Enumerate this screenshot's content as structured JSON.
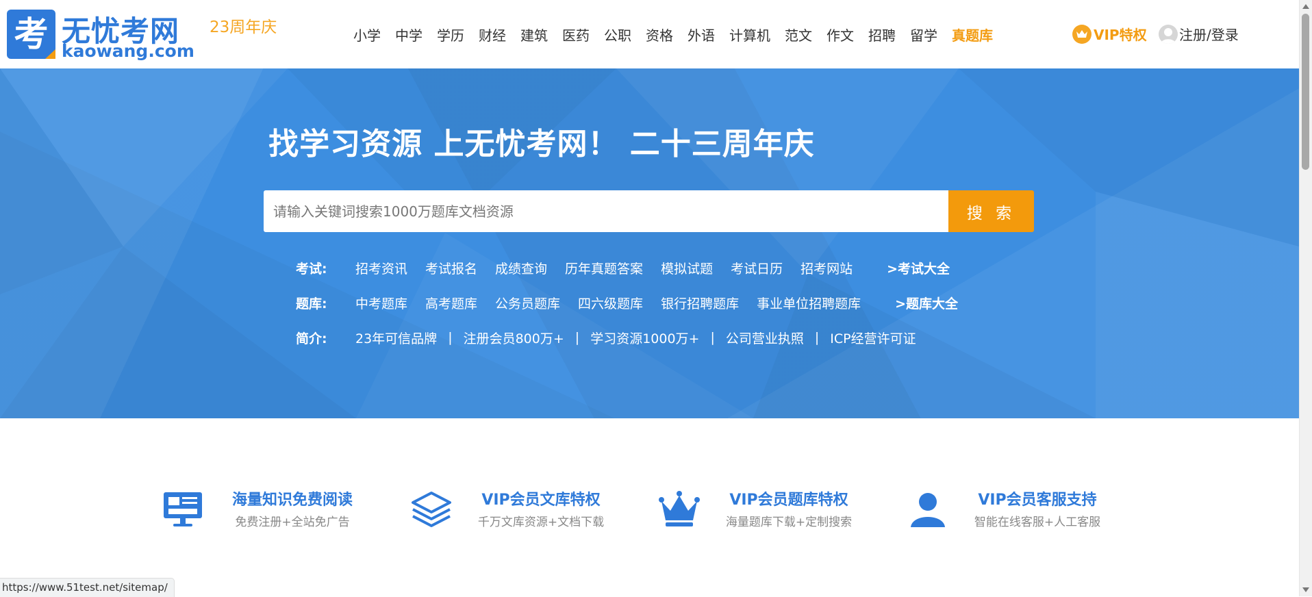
{
  "header": {
    "logo": {
      "mark": "考",
      "title": "无忧考网",
      "domain": "kaowang.com"
    },
    "anniversary": "23周年庆",
    "nav": [
      {
        "label": "小学"
      },
      {
        "label": "中学"
      },
      {
        "label": "学历"
      },
      {
        "label": "财经"
      },
      {
        "label": "建筑"
      },
      {
        "label": "医药"
      },
      {
        "label": "公职"
      },
      {
        "label": "资格"
      },
      {
        "label": "外语"
      },
      {
        "label": "计算机"
      },
      {
        "label": "范文"
      },
      {
        "label": "作文"
      },
      {
        "label": "招聘"
      },
      {
        "label": "留学"
      },
      {
        "label": "真题库",
        "highlight": true
      }
    ],
    "vip_label": "VIP特权",
    "user_label": "注册/登录"
  },
  "hero": {
    "title": "找学习资源 上无忧考网！ 二十三周年庆",
    "search": {
      "placeholder": "请输入关键词搜索1000万题库文档资源",
      "button_label": "搜 索"
    },
    "rows": {
      "exam": {
        "label": "考试:",
        "links": [
          "招考资讯",
          "考试报名",
          "成绩查询",
          "历年真题答案",
          "模拟试题",
          "考试日历",
          "招考网站"
        ],
        "more": ">考试大全"
      },
      "bank": {
        "label": "题库:",
        "links": [
          "中考题库",
          "高考题库",
          "公务员题库",
          "四六级题库",
          "银行招聘题库",
          "事业单位招聘题库"
        ],
        "more": ">题库大全"
      },
      "intro": {
        "label": "简介:",
        "links": [
          "23年可信品牌",
          "注册会员800万+",
          "学习资源1000万+",
          "公司营业执照",
          "ICP经营许可证"
        ],
        "separator": "|"
      }
    }
  },
  "features": [
    {
      "icon": "monitor-icon",
      "title": "海量知识免费阅读",
      "subtitle": "免费注册+全站免广告"
    },
    {
      "icon": "layers-icon",
      "title": "VIP会员文库特权",
      "subtitle": "千万文库资源+文档下载"
    },
    {
      "icon": "crown-icon",
      "title": "VIP会员题库特权",
      "subtitle": "海量题库下载+定制搜索"
    },
    {
      "icon": "user-support-icon",
      "title": "VIP会员客服支持",
      "subtitle": "智能在线客服+人工客服"
    }
  ],
  "status_bar": {
    "url": "https://www.51test.net/sitemap/"
  },
  "colors": {
    "brand_blue": "#2f7ad9",
    "hero_blue": "#3d8ee0",
    "accent_orange": "#f39a0c"
  }
}
